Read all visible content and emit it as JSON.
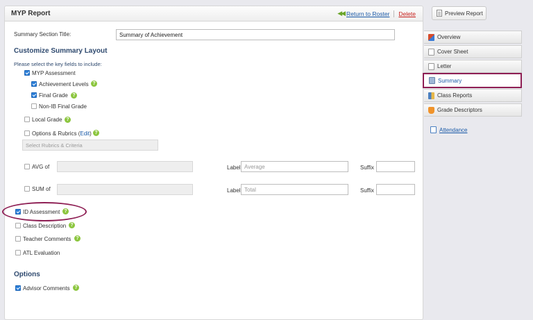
{
  "header": {
    "title": "MYP Report",
    "return_label": "Return to Roster",
    "delete_label": "Delete"
  },
  "summary_title": {
    "label": "Summary Section Title:",
    "value": "Summary of Achievement"
  },
  "layout": {
    "heading": "Customize Summary Layout",
    "instructions": "Please select the key fields to include:",
    "myp_assessment": {
      "label": "MYP Assessment",
      "checked": true
    },
    "achievement_levels": {
      "label": "Achievement Levels",
      "checked": true
    },
    "final_grade": {
      "label": "Final Grade",
      "checked": true
    },
    "non_ib_final_grade": {
      "label": "Non-IB Final Grade",
      "checked": false
    },
    "local_grade": {
      "label": "Local Grade",
      "checked": false
    },
    "options_rubrics": {
      "label": "Options & Rubrics",
      "edit_label": "Edit",
      "checked": false
    },
    "rubrics_select": {
      "placeholder": "Select Rubrics & Criteria"
    },
    "avg": {
      "label": "AVG of",
      "label_caption": "Label",
      "label_placeholder": "Average",
      "suffix_caption": "Suffix",
      "checked": false
    },
    "sum": {
      "label": "SUM of",
      "label_caption": "Label",
      "label_placeholder": "Total",
      "suffix_caption": "Suffix",
      "checked": false
    },
    "id_assessment": {
      "label": "ID Assessment",
      "checked": true
    },
    "class_description": {
      "label": "Class Description",
      "checked": false
    },
    "teacher_comments": {
      "label": "Teacher Comments",
      "checked": false
    },
    "atl_evaluation": {
      "label": "ATL Evaluation",
      "checked": false
    }
  },
  "options": {
    "heading": "Options",
    "advisor_comments": {
      "label": "Advisor Comments",
      "checked": true
    }
  },
  "sidebar": {
    "preview_button": "Preview Report",
    "tabs": [
      {
        "label": "Overview",
        "icon": "overview-icon",
        "color": "#d64b2b"
      },
      {
        "label": "Cover Sheet",
        "icon": "cover-sheet-icon",
        "color": "#ffffff"
      },
      {
        "label": "Letter",
        "icon": "letter-icon",
        "color": "#ffffff"
      },
      {
        "label": "Summary",
        "icon": "summary-icon",
        "color": "#9fb7d6",
        "active": true
      },
      {
        "label": "Class Reports",
        "icon": "class-reports-icon",
        "color": "#4a7fc1"
      },
      {
        "label": "Grade Descriptors",
        "icon": "grade-descriptors-icon",
        "color": "#f0932b"
      }
    ],
    "attendance_link": "Attendance"
  },
  "colors": {
    "accent_blue": "#1a5aa8",
    "heading_blue": "#2f4a6f",
    "delete_red": "#c8201c",
    "help_green": "#8cc63f",
    "callout_maroon": "#8e1f54"
  }
}
